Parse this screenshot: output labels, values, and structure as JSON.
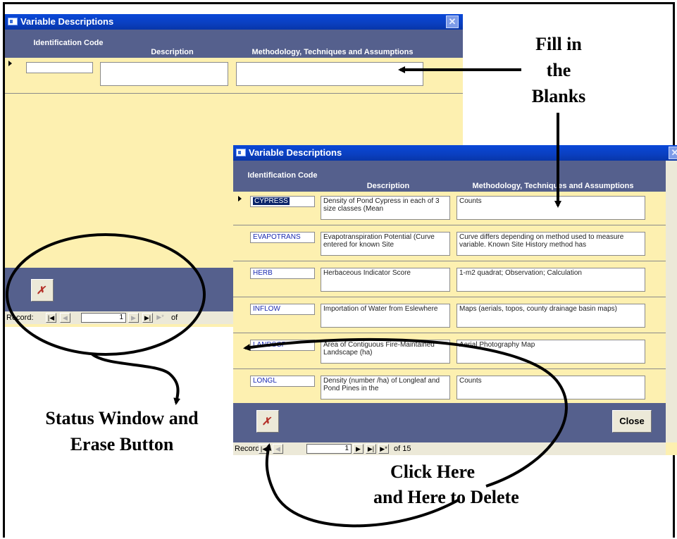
{
  "back_window": {
    "title": "Variable Descriptions",
    "columns": [
      "Identification Code",
      "Description",
      "Methodology, Techniques and Assumptions"
    ],
    "row": {
      "code": "",
      "description": "",
      "methodology": ""
    },
    "nav": {
      "record_label": "Record:",
      "current": "1",
      "of_label": "of"
    }
  },
  "front_window": {
    "title": "Variable Descriptions",
    "columns": [
      "Identification Code",
      "Description",
      "Methodology, Techniques and Assumptions"
    ],
    "rows": [
      {
        "code": "CYPRESS",
        "description": "Density of Pond Cypress in each of 3 size classes (Mean",
        "methodology": "Counts"
      },
      {
        "code": "EVAPOTRANS",
        "description": "Evapotranspiration Potential (Curve entered for known Site",
        "methodology": "Curve differs depending on method used to measure variable.  Known Site History method has"
      },
      {
        "code": "HERB",
        "description": "Herbaceous Indicator Score",
        "methodology": "1-m2 quadrat; Observation; Calculation"
      },
      {
        "code": "INFLOW",
        "description": "Importation of Water from Eslewhere",
        "methodology": "Maps (aerials, topos, county drainage basin maps)"
      },
      {
        "code": "LANDSCP",
        "description": "Area of Contiguous Fire-Maintained Landscape (ha)",
        "methodology": "Aerial Photography Map"
      },
      {
        "code": "LONGL",
        "description": "Density  (number /ha) of Longleaf and Pond Pines in the",
        "methodology": "Counts"
      }
    ],
    "close_label": "Close",
    "nav": {
      "record_label": "Record:",
      "current": "1",
      "of_label": "of 15"
    }
  },
  "annotations": {
    "fill_blanks": [
      "Fill in",
      "the",
      "Blanks"
    ],
    "status_erase": [
      "Status Window and",
      "Erase Button"
    ],
    "click_delete": [
      "Click Here",
      "and Here to Delete"
    ]
  },
  "icons": {
    "window": "form-icon",
    "erase": "delete-record-icon",
    "nav_first": "first-record-icon",
    "nav_prev": "previous-record-icon",
    "nav_next": "next-record-icon",
    "nav_last": "last-record-icon",
    "nav_new": "new-record-icon"
  }
}
